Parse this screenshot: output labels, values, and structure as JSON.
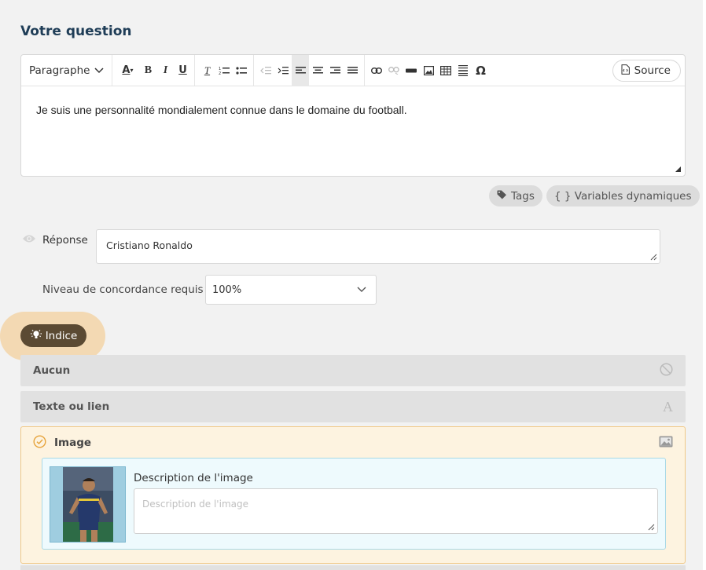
{
  "title": "Votre question",
  "editor": {
    "format_label": "Paragraphe",
    "source_label": "Source",
    "content": "Je suis une personnalité mondialement connue dans le domaine du football.",
    "toolbar": {
      "font_color": "A",
      "bold": "B",
      "italic": "I",
      "underline": "U",
      "clear_format": "T",
      "special_char": "Ω"
    }
  },
  "chips": {
    "tags_label": "Tags",
    "variables_label": "{ } Variables dynamiques"
  },
  "reponse": {
    "label": "Réponse",
    "value": "Cristiano Ronaldo"
  },
  "niveau": {
    "label": "Niveau de concordance requis",
    "selected": "100%"
  },
  "indice": {
    "label": "Indice"
  },
  "options": {
    "aucun": "Aucun",
    "texte": "Texte ou lien",
    "texte_icon_glyph": "A",
    "image": "Image"
  },
  "image_panel": {
    "description_label": "Description de l'image",
    "description_placeholder": "Description de l'image"
  },
  "colors": {
    "title": "#1f3d57",
    "indice_bg": "#5b4a33",
    "indice_halo": "#f3d9b3",
    "image_option_bg": "#fdf3e0",
    "image_option_border": "#f1c987",
    "check_icon": "#e6a33a"
  }
}
